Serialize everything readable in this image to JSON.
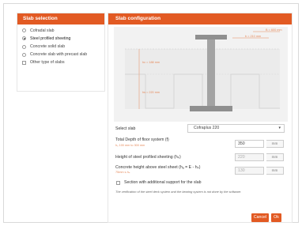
{
  "left_panel": {
    "title": "Slab selection",
    "options": [
      {
        "label": "Cofradal slab",
        "checked": false
      },
      {
        "label": "Steel profiled sheeting",
        "checked": true
      },
      {
        "label": "Concrete solid slab",
        "checked": false
      },
      {
        "label": "Concrete slab with precast slab",
        "checked": false
      },
      {
        "label": "Other type of slabs",
        "checked": false
      }
    ]
  },
  "right_panel": {
    "title": "Slab configuration",
    "diagram": {
      "dim_b": "B = 600 mm",
      "dim_width": "b = 210 mm",
      "dim_hc": "hc = 188 mm",
      "dim_hs": "hs = 220 mm"
    },
    "select_slab": {
      "label": "Select slab",
      "value": "Cofraplus 220"
    },
    "total_depth": {
      "label": "Total Depth of floor system (f)",
      "sub": "hₛ 100 mm to 300 mm",
      "value": "350",
      "unit": "mm"
    },
    "sheet_height": {
      "label": "Height of steel profiled sheeting (hₚ)",
      "value": "220",
      "unit": "mm"
    },
    "concrete_height": {
      "label": "Concrete height above steel sheet (hₐ = E - hₚ)",
      "sub": "75mm ≤ hₐ",
      "value": "130",
      "unit": "mm"
    },
    "additional_support": {
      "label": "Section with additional support for the slab"
    },
    "note": "The verification of the steel deck system and the bearing system is not done by the software.",
    "buttons": {
      "cancel": "Cancel",
      "ok": "Ok"
    }
  },
  "colors": {
    "accent": "#e25a23",
    "diagram_bg": "#f2f2f2",
    "beam": "#8f8f8f"
  }
}
